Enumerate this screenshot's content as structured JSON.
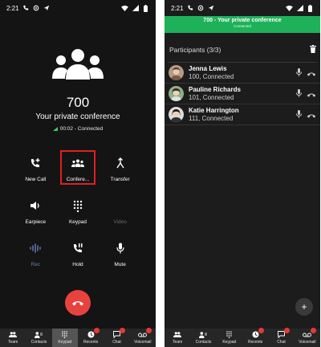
{
  "status_bar": {
    "time": "2:21"
  },
  "call_screen": {
    "conference_number": "700",
    "conference_name": "Your private conference",
    "call_timer": "00:02 - Connected",
    "controls": [
      [
        {
          "label": "New Call",
          "icon": "add-call-icon"
        },
        {
          "label": "Confere...",
          "icon": "conference-icon"
        },
        {
          "label": "Transfer",
          "icon": "transfer-icon"
        }
      ],
      [
        {
          "label": "Earpiece",
          "icon": "speaker-icon"
        },
        {
          "label": "Keypad",
          "icon": "dialpad-icon"
        },
        {
          "label": "Video",
          "icon": "video-icon"
        }
      ],
      [
        {
          "label": "Rec",
          "icon": "record-icon"
        },
        {
          "label": "Hold",
          "icon": "hold-icon"
        },
        {
          "label": "Mute",
          "icon": "mic-icon"
        }
      ]
    ],
    "colors": {
      "hangup": "#e8423f",
      "highlight_border": "#e02020",
      "rec_label": "#6a7fbd"
    }
  },
  "tabs": [
    {
      "label": "Team",
      "icon": "team-icon",
      "badge": false
    },
    {
      "label": "Contacts",
      "icon": "contacts-icon",
      "badge": false
    },
    {
      "label": "Keypad",
      "icon": "dialpad-icon",
      "badge": false
    },
    {
      "label": "Recents",
      "icon": "recents-icon",
      "badge": true
    },
    {
      "label": "Chat",
      "icon": "chat-icon",
      "badge": true
    },
    {
      "label": "Voicemail",
      "icon": "voicemail-icon",
      "badge": true
    }
  ],
  "left_active_tab": "Keypad",
  "conference_screen": {
    "banner_title": "700 - Your private conference",
    "banner_status": "Connected",
    "participants_title": "Participants",
    "participants_count": "(3/3)",
    "banner_color": "#1fb15a",
    "participants": [
      {
        "name": "Jenna Lewis",
        "detail": "100, Connected"
      },
      {
        "name": "Pauline Richards",
        "detail": "101, Connected"
      },
      {
        "name": "Katie Harrington",
        "detail": "111, Connected"
      }
    ]
  }
}
